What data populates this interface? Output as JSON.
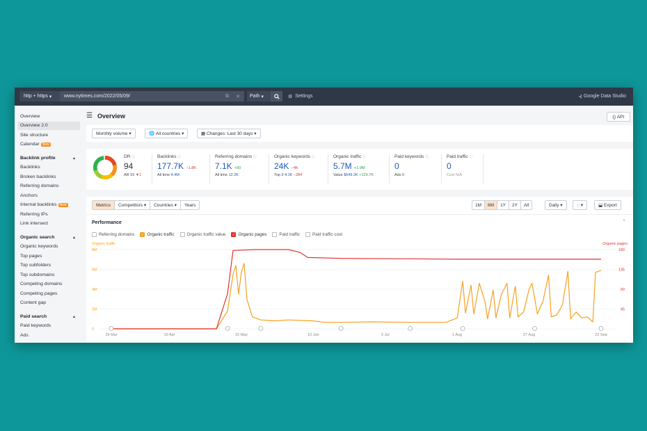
{
  "topbar": {
    "protocol": "http + https",
    "url": "www.nytimes.com/2022/05/09/",
    "path_label": "Path",
    "settings_label": "Settings",
    "gds_label": "Google Data Studio"
  },
  "sidebar": {
    "items": [
      {
        "label": "Overview"
      },
      {
        "label": "Overview 2.0"
      },
      {
        "label": "Site structure"
      },
      {
        "label": "Calendar",
        "badge": "New"
      },
      {
        "label": "Backlink profile",
        "section": true
      },
      {
        "label": "Backlinks"
      },
      {
        "label": "Broken backlinks"
      },
      {
        "label": "Referring domains"
      },
      {
        "label": "Anchors"
      },
      {
        "label": "Internal backlinks",
        "badge": "New"
      },
      {
        "label": "Referring IPs"
      },
      {
        "label": "Link intersect"
      },
      {
        "label": "Organic search",
        "section": true
      },
      {
        "label": "Organic keywords"
      },
      {
        "label": "Top pages"
      },
      {
        "label": "Top subfolders"
      },
      {
        "label": "Top subdomains"
      },
      {
        "label": "Competing domains"
      },
      {
        "label": "Competing pages"
      },
      {
        "label": "Content gap"
      },
      {
        "label": "Paid search",
        "section": true
      },
      {
        "label": "Paid keywords"
      },
      {
        "label": "Ads"
      }
    ]
  },
  "header": {
    "title": "Overview",
    "api_label": "API"
  },
  "filters": {
    "volume": "Monthly volume",
    "countries": "All countries",
    "changes": "Changes: Last 30 days"
  },
  "metrics": {
    "dr": {
      "label": "DR",
      "value": "94",
      "sub_label": "AR",
      "sub_value": "93",
      "sub_delta": "1"
    },
    "backlinks": {
      "label": "Backlinks",
      "value": "177.7K",
      "delta": "−1.8K",
      "sub_label": "All time",
      "sub_value": "4.4M"
    },
    "refdomains": {
      "label": "Referring domains",
      "value": "7.1K",
      "delta": "+50",
      "sub_label": "All time",
      "sub_value": "12.2K"
    },
    "orgkw": {
      "label": "Organic keywords",
      "value": "24K",
      "delta": "−4K",
      "sub_label": "Top 3",
      "sub_value": "4.1K",
      "sub_delta": "−284"
    },
    "orgtraffic": {
      "label": "Organic traffic",
      "value": "5.7M",
      "delta": "+1.9M",
      "sub_label": "Value",
      "sub_value": "$649.2K",
      "sub_delta": "+129.7K"
    },
    "paidkw": {
      "label": "Paid keywords",
      "value": "0",
      "sub_label": "Ads",
      "sub_value": "0"
    },
    "paidtraffic": {
      "label": "Paid traffic",
      "value": "0",
      "sub_label": "Cost",
      "sub_value": "N/A"
    }
  },
  "chart_tabs": [
    "Metrics",
    "Competitors",
    "Countries",
    "Years"
  ],
  "ranges": [
    "1M",
    "6M",
    "1Y",
    "2Y",
    "All"
  ],
  "daily_label": "Daily",
  "export_label": "Export",
  "performance": {
    "title": "Performance",
    "legend": [
      {
        "label": "Referring domains",
        "checked": false
      },
      {
        "label": "Organic traffic",
        "checked": true,
        "color": "#f5a020"
      },
      {
        "label": "Organic traffic value",
        "checked": false
      },
      {
        "label": "Organic pages",
        "checked": true,
        "color": "#e03131"
      },
      {
        "label": "Paid traffic",
        "checked": false
      },
      {
        "label": "Paid traffic cost",
        "checked": false
      }
    ]
  },
  "chart_data": {
    "type": "line",
    "ylabel_left": "Organic traffic",
    "ylabel_right": "Organic pages",
    "yticks_left": [
      "0",
      "2M",
      "4M",
      "6M",
      "8M"
    ],
    "yticks_right": [
      "45",
      "90",
      "135",
      "180"
    ],
    "xticks": [
      "29 Mar",
      "19 Apr",
      "15 May",
      "10 Jun",
      "6 Jul",
      "1 Aug",
      "27 Aug",
      "22 Sep"
    ],
    "ylim_left": [
      0,
      8000000
    ],
    "ylim_right": [
      0,
      180
    ],
    "series": [
      {
        "name": "Organic traffic",
        "color": "#f5a020",
        "axis": "left",
        "points": [
          [
            "29 Mar",
            0
          ],
          [
            "6 May",
            0
          ],
          [
            "10 May",
            1800000
          ],
          [
            "12 May",
            5500000
          ],
          [
            "13 May",
            6400000
          ],
          [
            "14 May",
            3500000
          ],
          [
            "15 May",
            5700000
          ],
          [
            "16 May",
            6600000
          ],
          [
            "17 May",
            3000000
          ],
          [
            "19 May",
            1200000
          ],
          [
            "22 May",
            900000
          ],
          [
            "27 May",
            800000
          ],
          [
            "1 Jun",
            900000
          ],
          [
            "10 Jun",
            800000
          ],
          [
            "14 Jun",
            650000
          ],
          [
            "20 Jun",
            650000
          ],
          [
            "1 Jul",
            700000
          ],
          [
            "15 Jul",
            650000
          ],
          [
            "28 Jul",
            650000
          ],
          [
            "1 Aug",
            1100000
          ],
          [
            "3 Aug",
            4800000
          ],
          [
            "4 Aug",
            1600000
          ],
          [
            "6 Aug",
            4400000
          ],
          [
            "7 Aug",
            1500000
          ],
          [
            "9 Aug",
            4600000
          ],
          [
            "11 Aug",
            2800000
          ],
          [
            "12 Aug",
            1000000
          ],
          [
            "14 Aug",
            3900000
          ],
          [
            "15 Aug",
            1100000
          ],
          [
            "17 Aug",
            3500000
          ],
          [
            "19 Aug",
            4600000
          ],
          [
            "20 Aug",
            1100000
          ],
          [
            "22 Aug",
            4300000
          ],
          [
            "23 Aug",
            1200000
          ],
          [
            "25 Aug",
            1700000
          ],
          [
            "27 Aug",
            4000000
          ],
          [
            "28 Aug",
            4600000
          ],
          [
            "30 Aug",
            1500000
          ],
          [
            "1 Sep",
            2800000
          ],
          [
            "3 Sep",
            5400000
          ],
          [
            "4 Sep",
            1200000
          ],
          [
            "6 Sep",
            1400000
          ],
          [
            "8 Sep",
            2400000
          ],
          [
            "10 Sep",
            5800000
          ],
          [
            "11 Sep",
            1000000
          ],
          [
            "13 Sep",
            1700000
          ],
          [
            "15 Sep",
            1100000
          ],
          [
            "17 Sep",
            1200000
          ],
          [
            "19 Sep",
            700000
          ],
          [
            "20 Sep",
            5700000
          ],
          [
            "22 Sep",
            5900000
          ]
        ]
      },
      {
        "name": "Organic pages",
        "color": "#e03131",
        "axis": "right",
        "points": [
          [
            "29 Mar",
            0
          ],
          [
            "6 May",
            0
          ],
          [
            "10 May",
            80
          ],
          [
            "12 May",
            178
          ],
          [
            "20 May",
            180
          ],
          [
            "1 Jun",
            180
          ],
          [
            "5 Jun",
            174
          ],
          [
            "8 Jun",
            162
          ],
          [
            "20 Jun",
            160
          ],
          [
            "15 Jul",
            159
          ],
          [
            "1 Aug",
            158
          ],
          [
            "27 Aug",
            158
          ],
          [
            "22 Sep",
            158
          ]
        ]
      }
    ]
  }
}
